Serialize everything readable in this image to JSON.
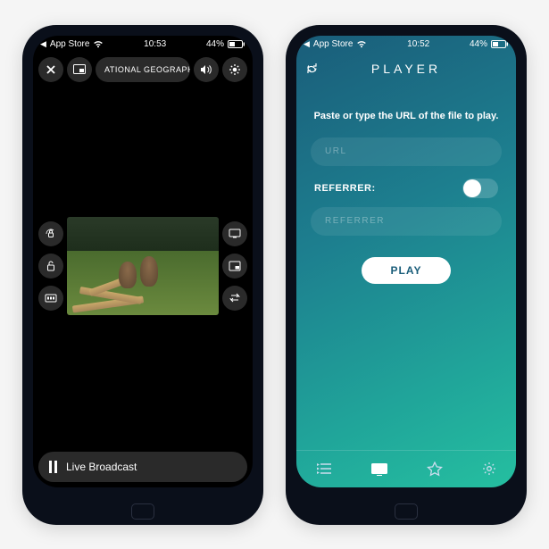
{
  "left": {
    "status": {
      "back": "App Store",
      "time": "10:53",
      "battery": "44%"
    },
    "toolbar": {
      "title": "ATIONAL GEOGRAPHIC"
    },
    "side_icons": {
      "left": [
        "rotation-lock-icon",
        "unlock-icon",
        "quality-icon"
      ],
      "right": [
        "display-icon",
        "pip-icon",
        "loop-icon"
      ]
    },
    "bottom": {
      "label": "Live Broadcast"
    }
  },
  "right": {
    "status": {
      "back": "App Store",
      "time": "10:52",
      "battery": "44%"
    },
    "title": "PLAYER",
    "prompt": "Paste or type the URL of the file to play.",
    "url_placeholder": "URL",
    "referrer_label": "REFERRER:",
    "referrer_placeholder": "REFERRER",
    "play_label": "PLAY",
    "tabs": [
      "playlist-icon",
      "screen-icon",
      "star-icon",
      "gear-icon"
    ]
  }
}
